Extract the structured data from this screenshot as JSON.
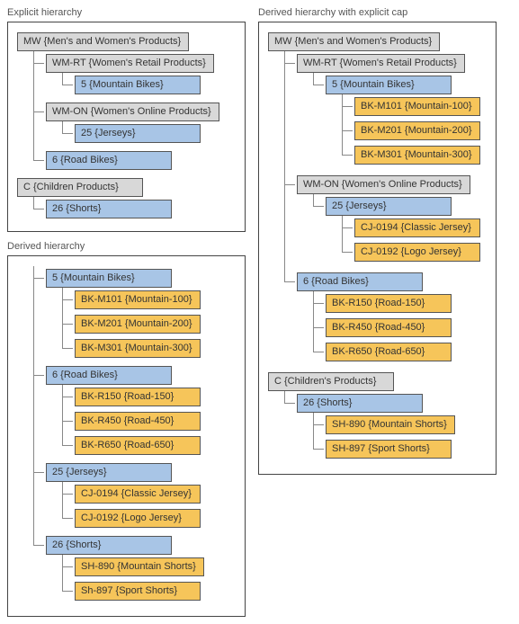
{
  "explicit": {
    "title": "Explicit hierarchy",
    "nodes": {
      "mw": "MW {Men's and Women's Products}",
      "wmrt": "WM-RT {Women's Retail Products}",
      "n5": "5 {Mountain Bikes}",
      "wmon": "WM-ON {Women's Online Products}",
      "n25": "25 {Jerseys}",
      "n6": "6 {Road Bikes}",
      "c": "C {Children Products}",
      "n26": "26 {Shorts}"
    }
  },
  "derived": {
    "title": "Derived hierarchy",
    "nodes": {
      "n5": "5 {Mountain Bikes}",
      "m101": "BK-M101 {Mountain-100}",
      "m201": "BK-M201 {Mountain-200}",
      "m301": "BK-M301 {Mountain-300}",
      "n6": "6 {Road Bikes}",
      "r150": "BK-R150 {Road-150}",
      "r450": "BK-R450 {Road-450}",
      "r650": "BK-R650 {Road-650}",
      "n25": "25 {Jerseys}",
      "cj194": "CJ-0194 {Classic Jersey}",
      "cj192": "CJ-0192 {Logo Jersey}",
      "n26": "26 {Shorts}",
      "sh890": "SH-890 {Mountain Shorts}",
      "sh897": "Sh-897 {Sport Shorts}"
    }
  },
  "capped": {
    "title": "Derived hierarchy with explicit cap",
    "nodes": {
      "mw": "MW {Men's and Women's Products}",
      "wmrt": "WM-RT {Women's Retail Products}",
      "n5": "5 {Mountain Bikes}",
      "m101": "BK-M101 {Mountain-100}",
      "m201": "BK-M201 {Mountain-200}",
      "m301": "BK-M301 {Mountain-300}",
      "wmon": "WM-ON {Women's Online Products}",
      "n25": "25 {Jerseys}",
      "cj194": "CJ-0194 {Classic Jersey}",
      "cj192": "CJ-0192 {Logo Jersey}",
      "n6": "6 {Road Bikes}",
      "r150": "BK-R150 {Road-150}",
      "r450": "BK-R450 {Road-450}",
      "r650": "BK-R650 {Road-650}",
      "c": "C {Children's Products}",
      "n26": "26 {Shorts}",
      "sh890": "SH-890 {Mountain Shorts}",
      "sh897": "SH-897 {Sport Shorts}"
    }
  }
}
